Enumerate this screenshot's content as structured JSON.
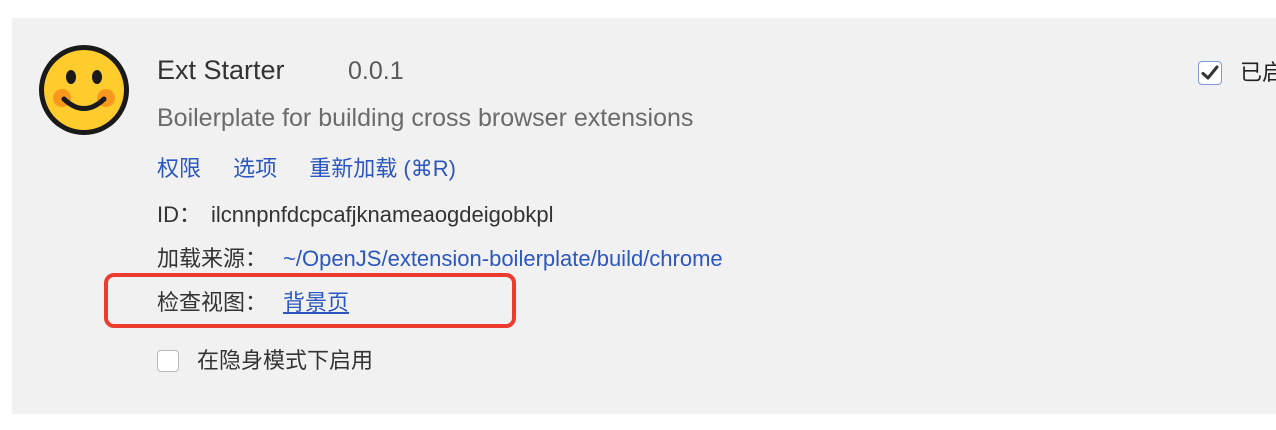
{
  "extension": {
    "name": "Ext Starter",
    "version": "0.0.1",
    "description": "Boilerplate for building cross browser extensions",
    "links": {
      "permissions": "权限",
      "options": "选项",
      "reload": "重新加载 (⌘R)"
    },
    "id_label": "ID：",
    "id_value": "ilcnnpnfdcpcafjknameaogdeigobkpl",
    "source_label": "加载来源：",
    "source_value": "~/OpenJS/extension-boilerplate/build/chrome",
    "inspect_label": "检查视图：",
    "inspect_value": "背景页",
    "incognito_label": "在隐身模式下启用",
    "incognito_checked": false,
    "enabled_label": "已启",
    "enabled_checked": true,
    "icon": "smiley-face-icon"
  },
  "colors": {
    "link": "#2c57c0",
    "highlight": "#ec3b2f",
    "panel": "#f1f1f1",
    "icon_yellow": "#ffcc2e",
    "icon_cheek": "#f7941d"
  }
}
